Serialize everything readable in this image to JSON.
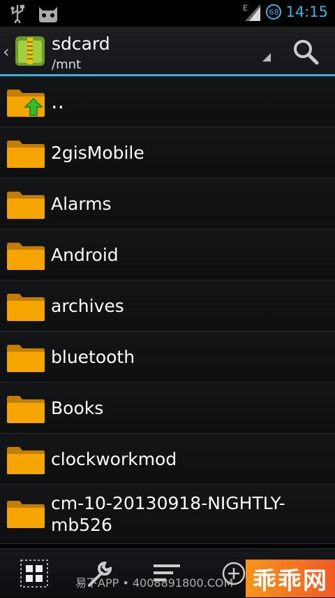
{
  "status_bar": {
    "time": "14:15",
    "battery_level": "68",
    "network_type": "E",
    "icons": [
      "usb-icon",
      "android-debug-icon",
      "signal-icon",
      "battery-icon"
    ]
  },
  "action_bar": {
    "title": "sdcard",
    "subtitle": "/mnt",
    "icons": [
      "back-chevron-icon",
      "archive-app-icon",
      "dropdown-arrow-icon",
      "search-icon"
    ]
  },
  "files": [
    {
      "name": "..",
      "type": "parent"
    },
    {
      "name": "2gisMobile",
      "type": "folder"
    },
    {
      "name": "Alarms",
      "type": "folder"
    },
    {
      "name": "Android",
      "type": "folder"
    },
    {
      "name": "archives",
      "type": "folder"
    },
    {
      "name": "bluetooth",
      "type": "folder"
    },
    {
      "name": "Books",
      "type": "folder"
    },
    {
      "name": "clockworkmod",
      "type": "folder"
    },
    {
      "name": "cm-10-20130918-NIGHTLY-mb526",
      "type": "folder"
    }
  ],
  "bottom_bar": {
    "icons": [
      "grid-view-icon",
      "tools-icon",
      "sort-icon",
      "add-icon"
    ]
  },
  "watermark": {
    "text": "易下APP • 4008891800.COM",
    "brand": "乖乖网"
  },
  "colors": {
    "accent": "#33b5e5",
    "folder": "#f6a400",
    "up_arrow": "#2fbf2f",
    "brand": "#f7941d"
  }
}
